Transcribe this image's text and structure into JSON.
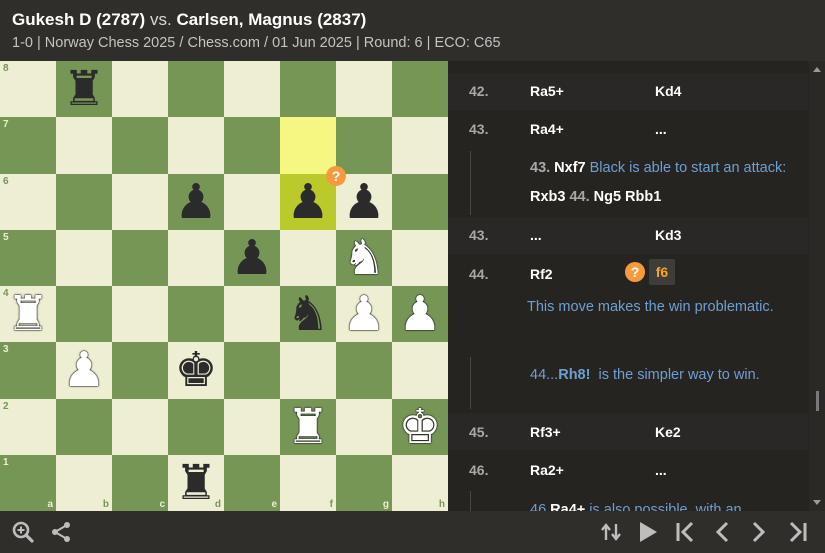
{
  "header": {
    "white_player": "Gukesh D (2787)",
    "vs": "vs.",
    "black_player": "Carlsen, Magnus (2837)",
    "result": "1-0",
    "event": "Norway Chess 2025",
    "site": "Chess.com",
    "date": "01 Jun 2025",
    "round": "Round: 6",
    "eco": "ECO: C65",
    "separator": " | ",
    "slash": " / "
  },
  "board": {
    "ranks": [
      "8",
      "7",
      "6",
      "5",
      "4",
      "3",
      "2",
      "1"
    ],
    "files": [
      "a",
      "b",
      "c",
      "d",
      "e",
      "f",
      "g",
      "h"
    ],
    "highlight_squares": [
      "f7",
      "f6"
    ],
    "annotation_square": "f6",
    "annotation_symbol": "?",
    "pieces": [
      {
        "square": "b8",
        "glyph": "♜",
        "color": "black",
        "name": "black-rook"
      },
      {
        "square": "d6",
        "glyph": "♟",
        "color": "black",
        "name": "black-pawn"
      },
      {
        "square": "f6",
        "glyph": "♟",
        "color": "black",
        "name": "black-pawn"
      },
      {
        "square": "g6",
        "glyph": "♟",
        "color": "black",
        "name": "black-pawn"
      },
      {
        "square": "e5",
        "glyph": "♟",
        "color": "black",
        "name": "black-pawn"
      },
      {
        "square": "g5",
        "glyph": "♞",
        "color": "white",
        "name": "white-knight"
      },
      {
        "square": "a4",
        "glyph": "♜",
        "color": "white",
        "name": "white-rook"
      },
      {
        "square": "f4",
        "glyph": "♞",
        "color": "black",
        "name": "black-knight"
      },
      {
        "square": "g4",
        "glyph": "♟",
        "color": "white",
        "name": "white-pawn"
      },
      {
        "square": "h4",
        "glyph": "♟",
        "color": "white",
        "name": "white-pawn"
      },
      {
        "square": "b3",
        "glyph": "♟",
        "color": "white",
        "name": "white-pawn"
      },
      {
        "square": "d3",
        "glyph": "♚",
        "color": "black",
        "name": "black-king"
      },
      {
        "square": "f2",
        "glyph": "♜",
        "color": "white",
        "name": "white-rook"
      },
      {
        "square": "h2",
        "glyph": "♚",
        "color": "white",
        "name": "white-king"
      },
      {
        "square": "d1",
        "glyph": "♜",
        "color": "black",
        "name": "black-rook"
      }
    ]
  },
  "moves": {
    "r42": {
      "num": "42.",
      "white": "Ra5+",
      "black": "Kd4"
    },
    "r43": {
      "num": "43.",
      "white": "Ra4+",
      "black": "..."
    },
    "var43": {
      "num": "43.",
      "move1": "Nxf7",
      "comment": "Black is able to start an attack:",
      "move2": "Rxb3",
      "num2": "44.",
      "move3": "Ng5",
      "move4": "Rbb1"
    },
    "r43b": {
      "num": "43.",
      "white": "...",
      "black": "Kd3"
    },
    "r44": {
      "num": "44.",
      "white": "Rf2",
      "annotation": "?",
      "black": "f6"
    },
    "comment44": "This move makes the win problematic.",
    "var44": {
      "num": "44...",
      "move": "Rh8!",
      "text": "is the simpler way to win."
    },
    "r45": {
      "num": "45.",
      "white": "Rf3+",
      "black": "Ke2"
    },
    "r46": {
      "num": "46.",
      "white": "Ra2+",
      "black": "..."
    },
    "var46_partial": {
      "num": "46.",
      "move": "Ra4+",
      "text": "is also possible, with an"
    }
  },
  "toolbar": {
    "left_icons": [
      "zoom-icon",
      "share-icon"
    ],
    "right_icons": [
      "flip-board-icon",
      "play-icon",
      "first-move-icon",
      "prev-move-icon",
      "next-move-icon",
      "last-move-icon"
    ]
  },
  "colors": {
    "light_square": "#eeeed2",
    "dark_square": "#769656",
    "highlight_light": "#f6f682",
    "highlight_dark": "#baca2b",
    "annotation": "#f79a3e",
    "comment_text": "#6d9fd2"
  }
}
